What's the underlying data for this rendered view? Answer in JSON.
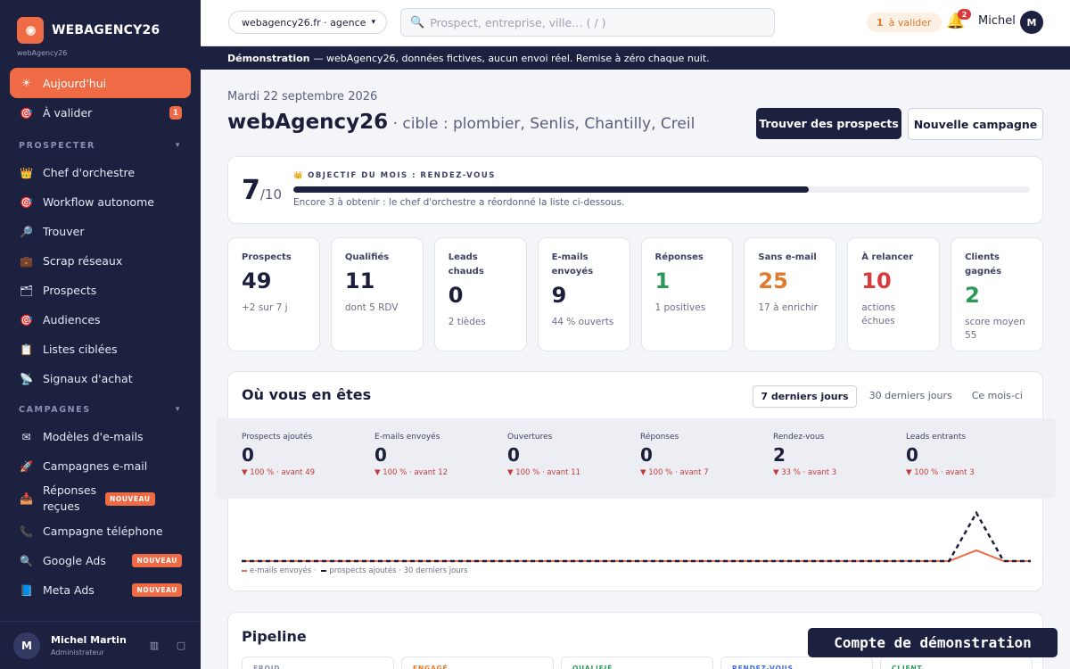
{
  "brand": {
    "name": "WEBAGENCY26",
    "sub": "webAgency26"
  },
  "sidebar": {
    "top_items": [
      {
        "label": "Aujourd'hui",
        "icon": "sun-icon"
      },
      {
        "label": "À valider",
        "icon": "target-icon",
        "badge": "1"
      }
    ],
    "sections": [
      {
        "title": "PROSPECTER",
        "items": [
          {
            "label": "Chef d'orchestre",
            "icon": "crown-icon"
          },
          {
            "label": "Workflow autonome",
            "icon": "target-icon"
          },
          {
            "label": "Trouver",
            "icon": "magnifier-icon"
          },
          {
            "label": "Scrap réseaux",
            "icon": "briefcase-icon"
          },
          {
            "label": "Prospects",
            "icon": "folder-icon"
          },
          {
            "label": "Audiences",
            "icon": "target-icon"
          },
          {
            "label": "Listes ciblées",
            "icon": "clipboard-icon"
          },
          {
            "label": "Signaux d'achat",
            "icon": "satellite-icon"
          }
        ]
      },
      {
        "title": "CAMPAGNES",
        "items": [
          {
            "label": "Modèles d'e-mails",
            "icon": "envelope-icon"
          },
          {
            "label": "Campagnes e-mail",
            "icon": "rocket-icon"
          },
          {
            "label": "Réponses reçues",
            "icon": "inbox-icon",
            "badge": "NOUVEAU"
          },
          {
            "label": "Campagne téléphone",
            "icon": "phone-icon"
          },
          {
            "label": "Google Ads",
            "icon": "search-icon",
            "badge": "NOUVEAU"
          },
          {
            "label": "Meta Ads",
            "icon": "meta-icon",
            "badge": "NOUVEAU"
          }
        ]
      }
    ],
    "user": {
      "initial": "M",
      "name": "Michel Martin",
      "role": "Administrateur"
    }
  },
  "topbar": {
    "agency_select": "webagency26.fr · agence",
    "search_placeholder": "Prospect, entreprise, ville…  ( / )",
    "to_validate_count": "1",
    "to_validate_label": "à valider",
    "notifications": "2",
    "user_name": "Michel",
    "user_initial": "M"
  },
  "banner": {
    "bold": "Démonstration",
    "text": "— webAgency26, données fictives, aucun envoi réel. Remise à zéro chaque nuit."
  },
  "header": {
    "date": "Mardi 22 septembre 2026",
    "title": "webAgency26",
    "target": " · cible : plombier, Senlis, Chantilly, Creil",
    "find_button": "Trouver des prospects",
    "new_campaign_button": "Nouvelle campagne"
  },
  "goal": {
    "current": "7",
    "total": "/10",
    "label": "OBJECTIF DU MOIS : RENDEZ-VOUS",
    "progress": 0.7,
    "note": "Encore 3 à obtenir : le chef d'orchestre a réordonné la liste ci-dessous."
  },
  "stats": [
    {
      "label": "Prospects",
      "value": "49",
      "sub": "+2 sur 7 j",
      "tone": ""
    },
    {
      "label": "Qualifiés",
      "value": "11",
      "sub": "dont 5 RDV",
      "tone": ""
    },
    {
      "label": "Leads chauds",
      "value": "0",
      "sub": "2 tièdes",
      "tone": ""
    },
    {
      "label": "E-mails envoyés",
      "value": "9",
      "sub": "44 % ouverts",
      "tone": ""
    },
    {
      "label": "Réponses",
      "value": "1",
      "sub": "1 positives",
      "tone": "green"
    },
    {
      "label": "Sans e-mail",
      "value": "25",
      "sub": "17 à enrichir",
      "tone": "orange"
    },
    {
      "label": "À relancer",
      "value": "10",
      "sub": "actions échues",
      "tone": "red"
    },
    {
      "label": "Clients gagnés",
      "value": "2",
      "sub": "score moyen 55",
      "tone": "green"
    }
  ],
  "progress": {
    "title": "Où vous en êtes",
    "ranges": [
      "7 derniers jours",
      "30 derniers jours",
      "Ce mois-ci"
    ],
    "active_range": 0,
    "metrics": [
      {
        "label": "Prospects ajoutés",
        "value": "0",
        "trend": "▼ 100 % · avant 49"
      },
      {
        "label": "E-mails envoyés",
        "value": "0",
        "trend": "▼ 100 % · avant 12"
      },
      {
        "label": "Ouvertures",
        "value": "0",
        "trend": "▼ 100 % · avant 11"
      },
      {
        "label": "Réponses",
        "value": "0",
        "trend": "▼ 100 % · avant 7"
      },
      {
        "label": "Rendez-vous",
        "value": "2",
        "trend": "▼ 33 % · avant 3"
      },
      {
        "label": "Leads entrants",
        "value": "0",
        "trend": "▼ 100 % · avant 3"
      }
    ],
    "legend_emails": "e-mails envoyés ·",
    "legend_prospects": "prospects ajoutés · 30 derniers jours"
  },
  "chart_data": {
    "type": "line",
    "x_count": 30,
    "series": [
      {
        "name": "e-mails envoyés",
        "color": "#ee6b45",
        "values": [
          0,
          0,
          0,
          0,
          0,
          0,
          0,
          0,
          0,
          0,
          0,
          0,
          0,
          0,
          0,
          0,
          0,
          0,
          0,
          0,
          0,
          0,
          0,
          0,
          0,
          0,
          0,
          2,
          0,
          0
        ]
      },
      {
        "name": "prospects ajoutés",
        "color": "#1d2140",
        "values": [
          0,
          0,
          0,
          0,
          0,
          0,
          0,
          0,
          0,
          0,
          0,
          0,
          0,
          0,
          0,
          0,
          0,
          0,
          0,
          0,
          0,
          0,
          0,
          0,
          0,
          0,
          0,
          9,
          0,
          0
        ]
      }
    ]
  },
  "pipeline": {
    "title": "Pipeline",
    "columns": [
      {
        "label": "FROID",
        "color": "#8a90af"
      },
      {
        "label": "ENGAGÉ",
        "color": "#e07a2c"
      },
      {
        "label": "QUALIFIÉ",
        "color": "#2b9a58"
      },
      {
        "label": "RENDEZ-VOUS",
        "color": "#3a6fd8"
      },
      {
        "label": "CLIENT",
        "color": "#2b9a58"
      }
    ]
  },
  "demo_account": "Compte de démonstration"
}
